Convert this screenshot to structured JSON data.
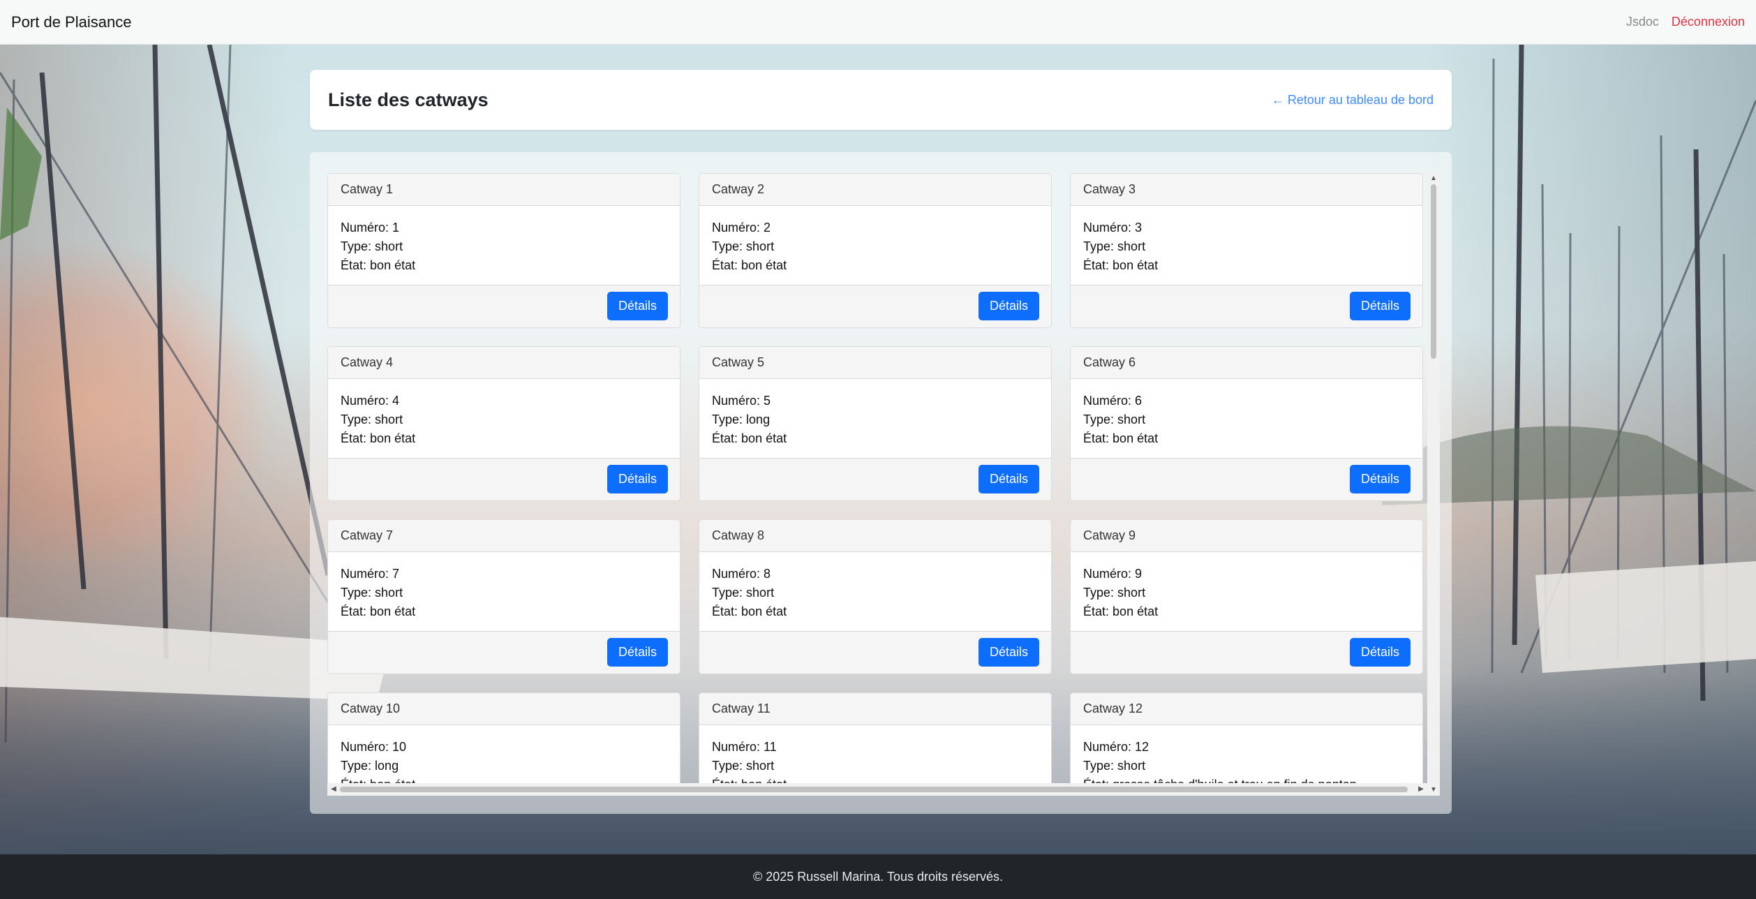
{
  "navbar": {
    "brand": "Port de Plaisance",
    "jsdoc": "Jsdoc",
    "logout": "Déconnexion"
  },
  "header": {
    "title": "Liste des catways",
    "back_link": "← Retour au tableau de bord"
  },
  "labels": {
    "numero": "Numéro:",
    "type": "Type:",
    "etat": "État:",
    "details": "Détails"
  },
  "catways": [
    {
      "title": "Catway 1",
      "numero": "1",
      "type": "short",
      "etat": "bon état"
    },
    {
      "title": "Catway 2",
      "numero": "2",
      "type": "short",
      "etat": "bon état"
    },
    {
      "title": "Catway 3",
      "numero": "3",
      "type": "short",
      "etat": "bon état"
    },
    {
      "title": "Catway 4",
      "numero": "4",
      "type": "short",
      "etat": "bon état"
    },
    {
      "title": "Catway 5",
      "numero": "5",
      "type": "long",
      "etat": "bon état"
    },
    {
      "title": "Catway 6",
      "numero": "6",
      "type": "short",
      "etat": "bon état"
    },
    {
      "title": "Catway 7",
      "numero": "7",
      "type": "short",
      "etat": "bon état"
    },
    {
      "title": "Catway 8",
      "numero": "8",
      "type": "short",
      "etat": "bon état"
    },
    {
      "title": "Catway 9",
      "numero": "9",
      "type": "short",
      "etat": "bon état"
    },
    {
      "title": "Catway 10",
      "numero": "10",
      "type": "long",
      "etat": "bon état"
    },
    {
      "title": "Catway 11",
      "numero": "11",
      "type": "short",
      "etat": "bon état"
    },
    {
      "title": "Catway 12",
      "numero": "12",
      "type": "short",
      "etat": "grosse tâche d'huile et trou en fin de ponton"
    }
  ],
  "footer": {
    "text": "© 2025 Russell Marina. Tous droits réservés."
  },
  "colors": {
    "primary": "#0d6efd",
    "logout": "#dc3545",
    "link": "#3d8bfd",
    "footer_bg": "#212529"
  }
}
